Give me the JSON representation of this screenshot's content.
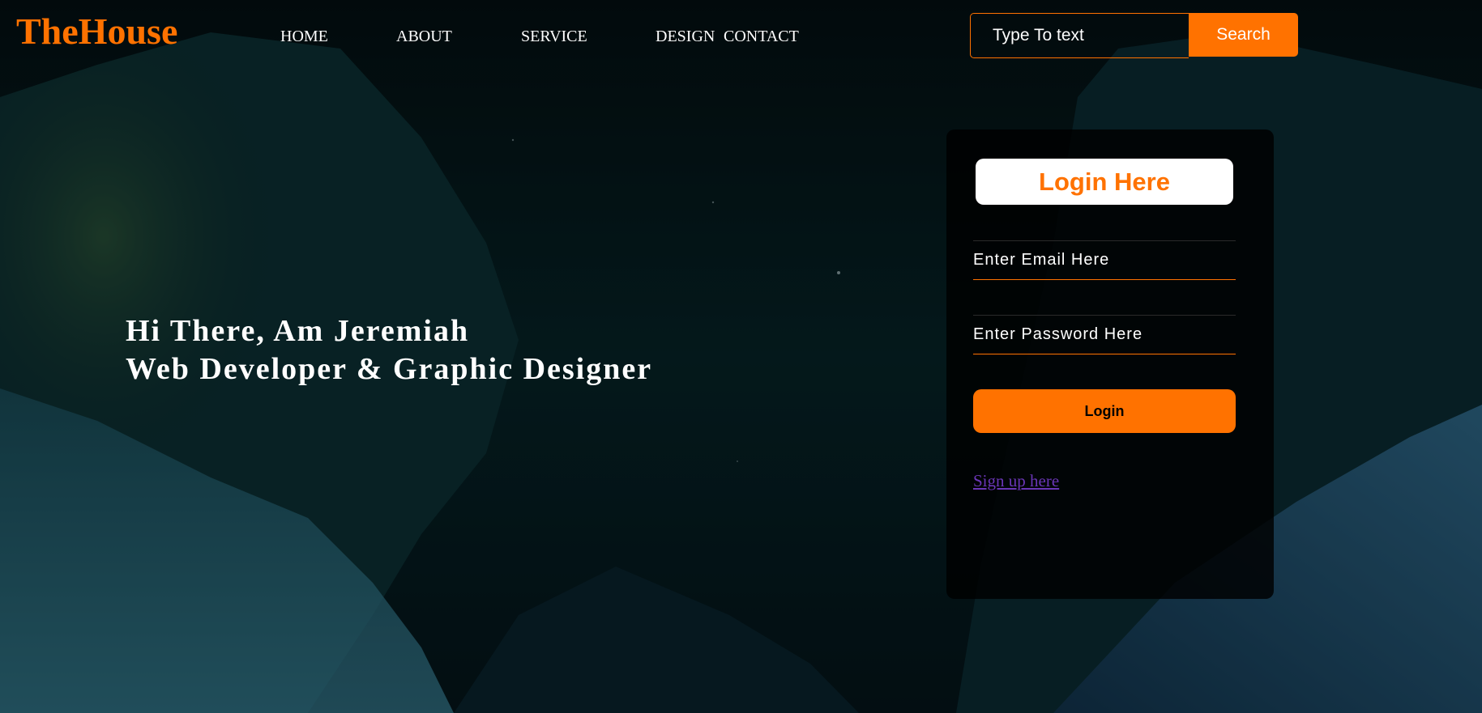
{
  "header": {
    "logo": "TheHouse",
    "nav": [
      {
        "label": "HOME"
      },
      {
        "label": "ABOUT"
      },
      {
        "label": "SERVICE"
      },
      {
        "label": "DESIGN"
      },
      {
        "label": "CONTACT"
      }
    ],
    "search": {
      "placeholder": "Type To text",
      "button_label": "Search"
    }
  },
  "hero": {
    "line1": "Hi There, Am Jeremiah",
    "line2": "Web Developer & Graphic Designer"
  },
  "login": {
    "title": "Login Here",
    "email_placeholder": "Enter Email Here",
    "password_placeholder": "Enter Password Here",
    "button_label": "Login",
    "signup_link": "Sign up here"
  },
  "colors": {
    "accent": "#ff7200",
    "link": "#6a36b6",
    "card": "#000000"
  }
}
